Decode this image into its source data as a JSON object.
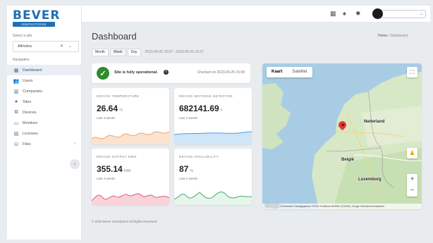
{
  "brand": {
    "name": "BEVER",
    "tag": "INNOVATIONS"
  },
  "sidebar": {
    "site_label": "Select a site",
    "site_value": "Alfredos",
    "nav_label": "Navigation",
    "items": [
      {
        "label": "Dashboard",
        "icon": "dashboard-icon"
      },
      {
        "label": "Users",
        "icon": "users-icon"
      },
      {
        "label": "Companies",
        "icon": "building-icon"
      },
      {
        "label": "Sites",
        "icon": "map-pin-icon"
      },
      {
        "label": "Devices",
        "icon": "devices-icon"
      },
      {
        "label": "Monitors",
        "icon": "monitor-icon"
      },
      {
        "label": "Licenses",
        "icon": "license-icon"
      },
      {
        "label": "Files",
        "icon": "files-icon"
      }
    ]
  },
  "header": {
    "title": "Dashboard",
    "breadcrumb_home": "Home",
    "breadcrumb_current": "Dashboard"
  },
  "range": {
    "buttons": [
      "Month",
      "Week",
      "Day"
    ],
    "date_range": "2023-09-25 15:07 - 2023-09-25 15:07"
  },
  "status": {
    "message": "Site is fully operational.",
    "checked": "Checked on 2023-09-25 15:08"
  },
  "cards": [
    {
      "title": "DEVICE TEMPERATURE",
      "value": "26.64",
      "unit": "°C",
      "sub": "Last 4 weeks",
      "color": "#f0a35e",
      "fill": "#fbe3cf"
    },
    {
      "title": "DEVICE MOTIONS DETECTED",
      "value": "682141.69",
      "unit": "#",
      "sub": "Last 4 weeks",
      "color": "#4a9be0",
      "fill": "#cfe5f8"
    },
    {
      "title": "DEVICE OUTPUT KWH",
      "value": "355.14",
      "unit": "kWh",
      "sub": "Last 4 weeks",
      "color": "#e05a72",
      "fill": "#f9d3da"
    },
    {
      "title": "DEVICE AVAILABILITY",
      "value": "87",
      "unit": "%",
      "sub": "Last 4 weeks",
      "color": "#3fae6a",
      "fill": "#e7f5ec"
    }
  ],
  "map": {
    "map_tab": "Kaart",
    "satellite_tab": "Satelliet",
    "labels": {
      "nederland": "Nederland",
      "belgie": "België",
      "luxemburg": "Luxemburg"
    },
    "attribution": "Sneltoetsen   Kaartgegevens ©2023 GeoBasis-DE/BKG (©2009), Google   Gebruiksvoorwaarden",
    "google": "Google"
  },
  "footer": {
    "text": "© 2023 Bever Innovations All Rights Reserved"
  }
}
